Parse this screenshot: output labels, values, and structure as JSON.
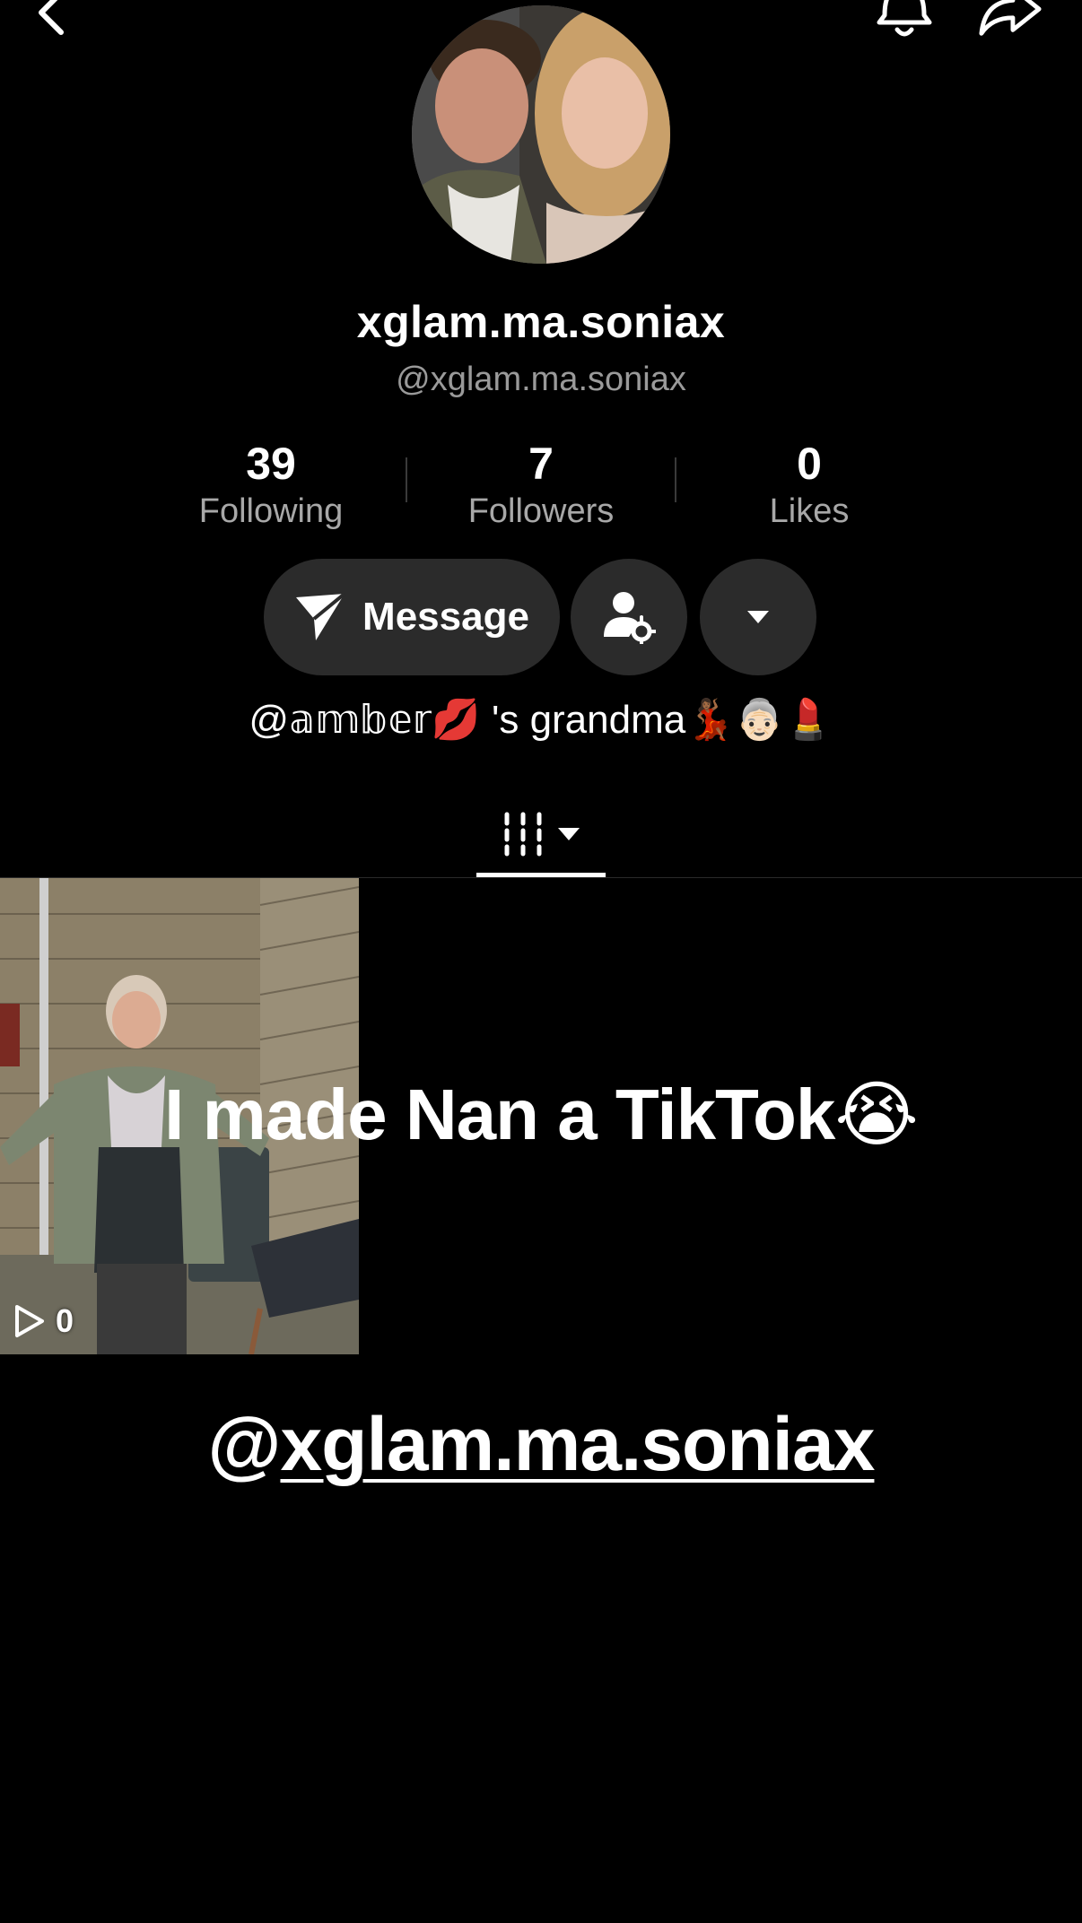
{
  "profile": {
    "display_name": "xglam.ma.soniax",
    "handle": "@xglam.ma.soniax"
  },
  "stats": [
    {
      "value": "39",
      "label": "Following"
    },
    {
      "value": "7",
      "label": "Followers"
    },
    {
      "value": "0",
      "label": "Likes"
    }
  ],
  "actions": {
    "message_label": "Message"
  },
  "bio": "@𝕒𝕞𝕓𝕖𝕣💋 's grandma💃🏾👵🏻💄",
  "icons": {
    "back": "chevron-left-icon",
    "notifications": "bell-icon",
    "share": "share-arrow-icon",
    "message": "paper-plane-icon",
    "friend_settings": "person-gear-icon",
    "more": "caret-down-icon",
    "grid_tab": "grid-icon",
    "play": "play-outline-icon"
  },
  "videos": [
    {
      "views": "0"
    }
  ],
  "overlay": {
    "title": "I made Nan a TikTok😭",
    "handle_at": "@",
    "handle_name": "xglam.ma.soniax"
  },
  "colors": {
    "background": "#000000",
    "button_bg": "#2b2b2b",
    "secondary_text": "#9a9a9a"
  }
}
